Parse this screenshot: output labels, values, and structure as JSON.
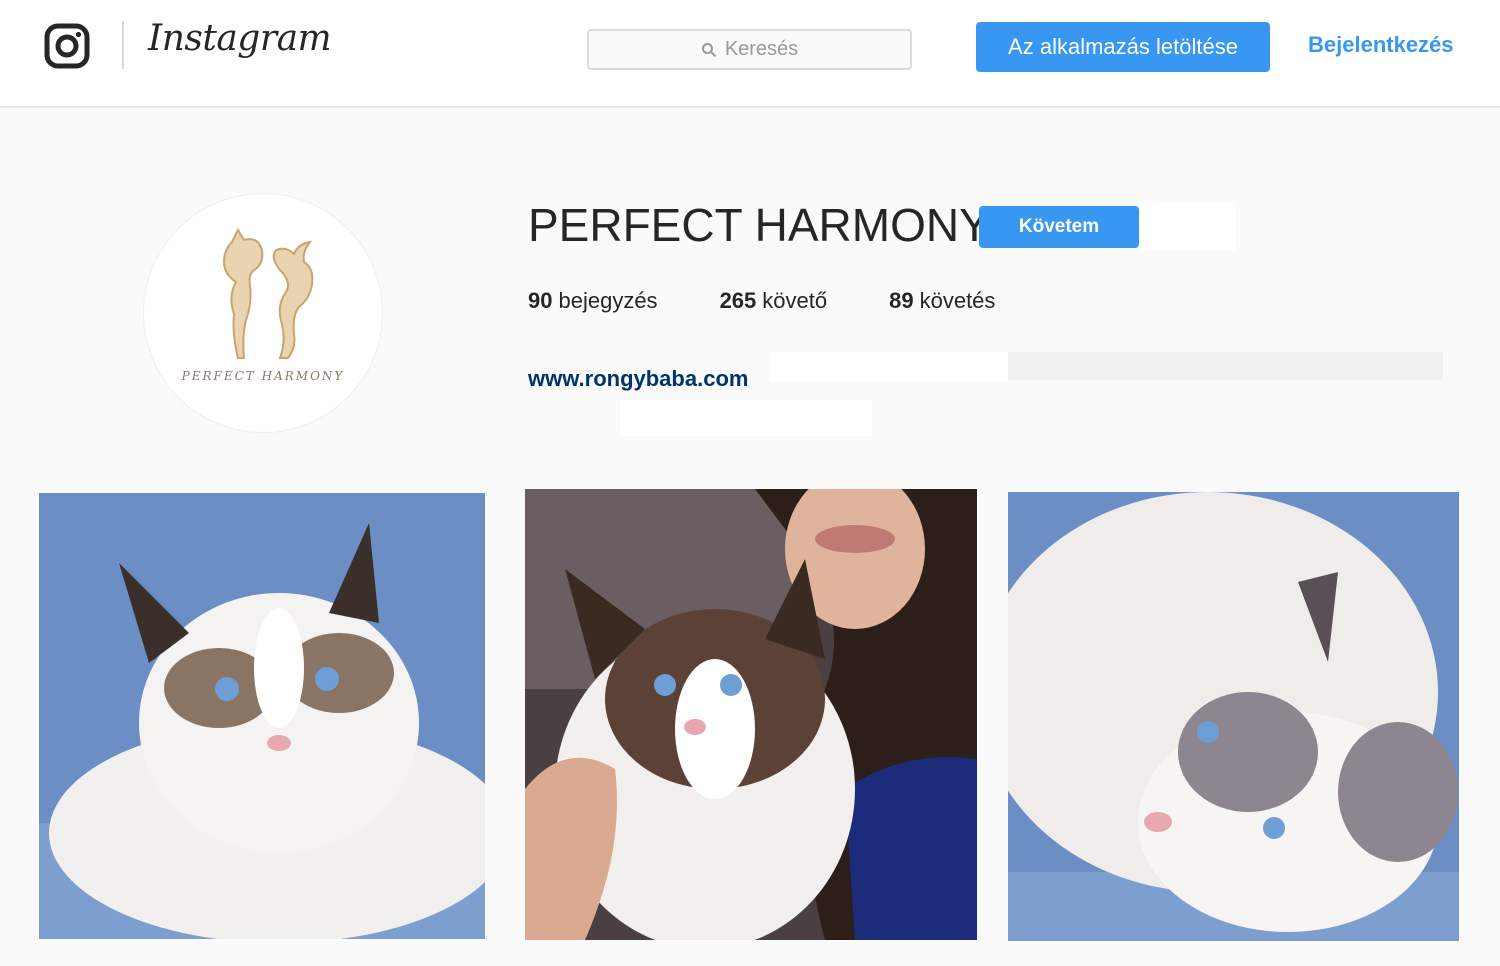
{
  "header": {
    "logo_icon": "camera-icon",
    "wordmark": "Instagram",
    "search_placeholder": "Keresés",
    "download_label": "Az alkalmazás letöltése",
    "login_label": "Bejelentkezés"
  },
  "profile": {
    "username": "PERFECT HARMONY",
    "follow_label": "Követem",
    "avatar_logo_text": "PERFECT HARMONY",
    "stats": [
      {
        "count": "90",
        "label": "bejegyzés"
      },
      {
        "count": "265",
        "label": "követő"
      },
      {
        "count": "89",
        "label": "követés"
      }
    ],
    "website": "www.rongybaba.com"
  },
  "posts": [
    {
      "icon": "cat-photo"
    },
    {
      "icon": "woman-with-cat-photo"
    },
    {
      "icon": "lying-cat-photo"
    }
  ],
  "colors": {
    "accent": "#3897f0",
    "link": "#003569",
    "background": "#fafafa"
  }
}
